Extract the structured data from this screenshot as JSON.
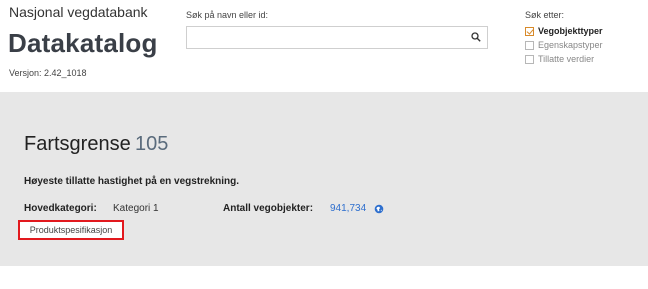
{
  "header": {
    "org": "Nasjonal vegdatabank",
    "title": "Datakatalog",
    "version": "Versjon: 2.42_1018"
  },
  "search": {
    "label": "Søk på navn eller id:",
    "value": "",
    "placeholder": ""
  },
  "filters": {
    "label": "Søk etter:",
    "items": [
      {
        "label": "Vegobjekttyper",
        "checked": true
      },
      {
        "label": "Egenskapstyper",
        "checked": false
      },
      {
        "label": "Tillatte verdier",
        "checked": false
      }
    ]
  },
  "object": {
    "name": "Fartsgrense",
    "id": "105",
    "description": "Høyeste tillatte hastighet på en vegstrekning.",
    "main_category_label": "Hovedkategori:",
    "main_category_value": "Kategori 1",
    "count_label": "Antall vegobjekter:",
    "count_value": "941,734",
    "spec_button": "Produktspesifikasjon"
  },
  "colors": {
    "accent": "#d88a2a",
    "link": "#2e6fce",
    "highlight": "#e2191e",
    "panel_bg": "#e7e7e7"
  }
}
